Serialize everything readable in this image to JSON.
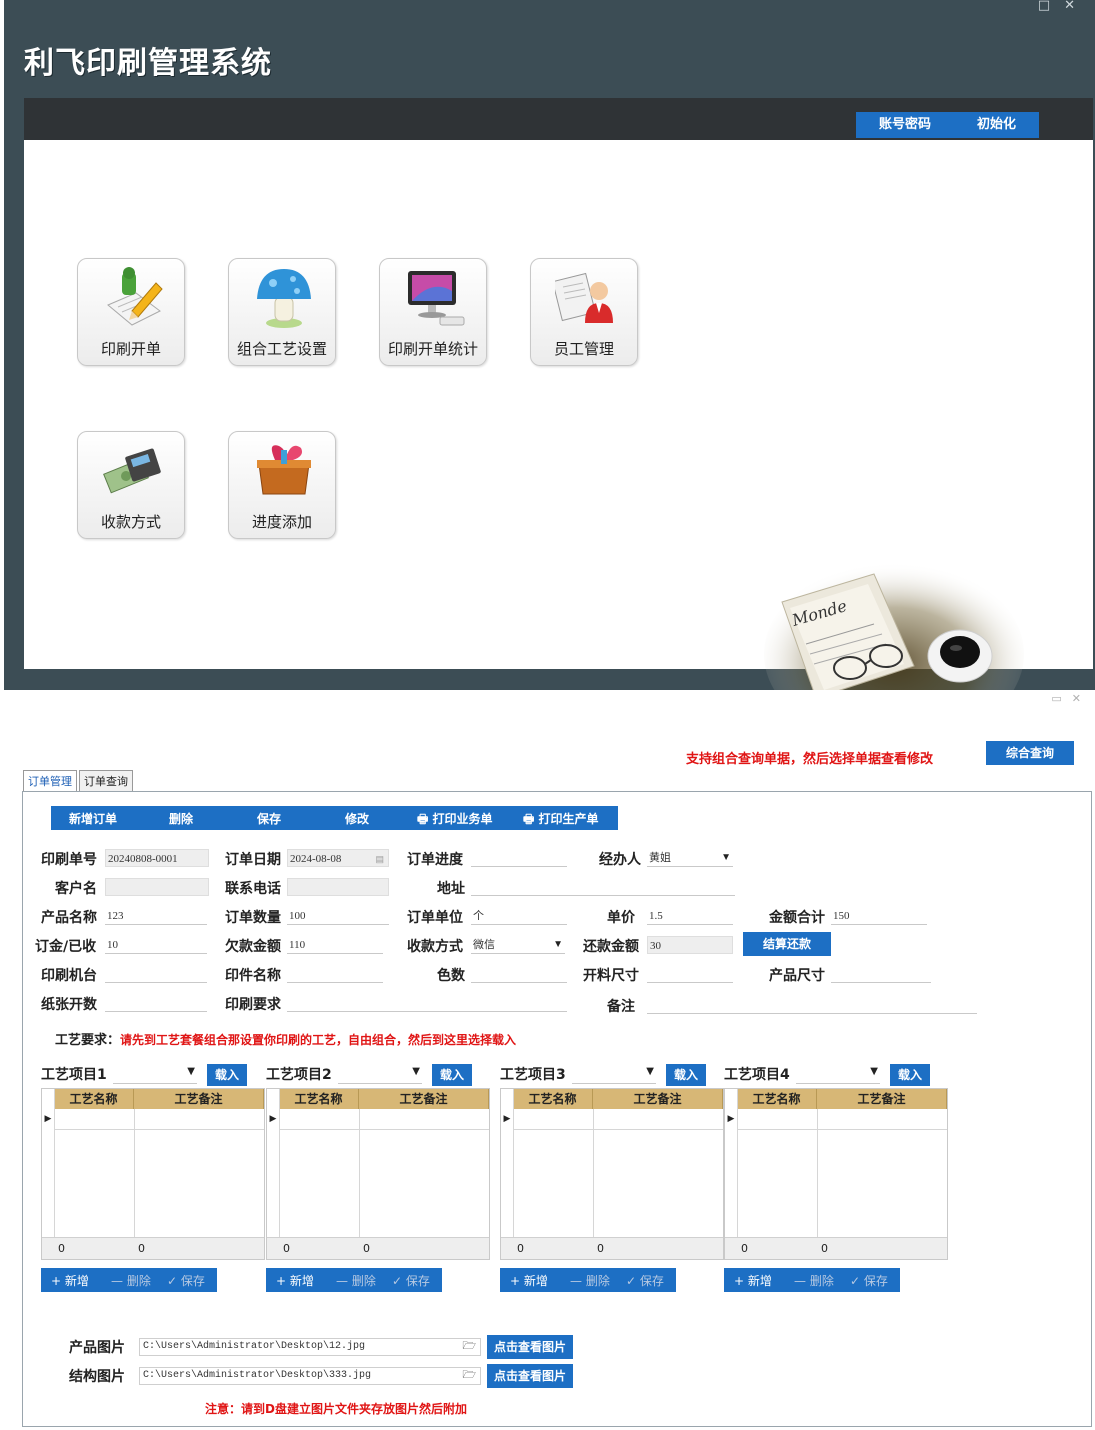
{
  "main_window": {
    "title": "利飞印刷管理系统",
    "top_actions": [
      "账号密码",
      "初始化"
    ],
    "tiles": [
      {
        "label": "印刷开单",
        "icon": "edit-pen-icon"
      },
      {
        "label": "组合工艺设置",
        "icon": "mushroom-icon"
      },
      {
        "label": "印刷开单统计",
        "icon": "computer-monitor-icon"
      },
      {
        "label": "员工管理",
        "icon": "employee-icon"
      },
      {
        "label": "收款方式",
        "icon": "money-card-icon"
      },
      {
        "label": "进度添加",
        "icon": "gift-box-icon"
      }
    ],
    "decor": {
      "newspaper_text": "Monde"
    }
  },
  "order_window": {
    "hint": "支持组合查询单据，然后选择单据查看修改",
    "combo_query_label": "综合查询",
    "tabs": [
      {
        "label": "订单管理",
        "active": true
      },
      {
        "label": "订单查询",
        "active": false
      }
    ],
    "toolbar": [
      "新增订单",
      "删除",
      "保存",
      "修改",
      "打印业务单",
      "打印生产单"
    ],
    "form": {
      "order_no": {
        "label": "印刷单号",
        "value": "20240808-0001"
      },
      "order_date": {
        "label": "订单日期",
        "value": "2024-08-08"
      },
      "progress": {
        "label": "订单进度",
        "value": ""
      },
      "handler": {
        "label": "经办人",
        "value": "黄姐"
      },
      "customer": {
        "label": "客户名",
        "value": ""
      },
      "phone": {
        "label": "联系电话",
        "value": ""
      },
      "address": {
        "label": "地址",
        "value": ""
      },
      "product_name": {
        "label": "产品名称",
        "value": "123"
      },
      "quantity": {
        "label": "订单数量",
        "value": "100"
      },
      "unit": {
        "label": "订单单位",
        "value": "个"
      },
      "unit_price": {
        "label": "单价",
        "value": "1.5"
      },
      "total": {
        "label": "金额合计",
        "value": "150"
      },
      "deposit": {
        "label": "订金/已收",
        "value": "10"
      },
      "owed": {
        "label": "欠款金额",
        "value": "110"
      },
      "pay_method": {
        "label": "收款方式",
        "value": "微信"
      },
      "repay": {
        "label": "还款金额",
        "value": "30"
      },
      "settle_label": "结算还款",
      "machine": {
        "label": "印刷机台",
        "value": ""
      },
      "print_name": {
        "label": "印件名称",
        "value": ""
      },
      "colors": {
        "label": "色数",
        "value": ""
      },
      "cut_size": {
        "label": "开料尺寸",
        "value": ""
      },
      "product_size": {
        "label": "产品尺寸",
        "value": ""
      },
      "paper_split": {
        "label": "纸张开数",
        "value": ""
      },
      "print_req": {
        "label": "印刷要求",
        "value": ""
      },
      "remark": {
        "label": "备注",
        "value": ""
      }
    },
    "process_requirement": {
      "label": "工艺要求：",
      "text": "请先到工艺套餐组合那设置你印刷的工艺，自由组合，然后到这里选择载入"
    },
    "process_items": [
      {
        "label": "工艺项目1",
        "load": "载入",
        "col1": "工艺名称",
        "col2": "工艺备注",
        "sum1": "0",
        "sum2": "0",
        "add": "+ 新增",
        "del": "— 删除",
        "save": "✓ 保存"
      },
      {
        "label": "工艺项目2",
        "load": "载入",
        "col1": "工艺名称",
        "col2": "工艺备注",
        "sum1": "0",
        "sum2": "0",
        "add": "+ 新增",
        "del": "— 删除",
        "save": "✓ 保存"
      },
      {
        "label": "工艺项目3",
        "load": "载入",
        "col1": "工艺名称",
        "col2": "工艺备注",
        "sum1": "0",
        "sum2": "0",
        "add": "+ 新增",
        "del": "— 删除",
        "save": "✓ 保存"
      },
      {
        "label": "工艺项目4",
        "load": "载入",
        "col1": "工艺名称",
        "col2": "工艺备注",
        "sum1": "0",
        "sum2": "0",
        "add": "+ 新增",
        "del": "— 删除",
        "save": "✓ 保存"
      }
    ],
    "images": [
      {
        "label": "产品图片",
        "path": "C:\\Users\\Administrator\\Desktop\\12.jpg",
        "view": "点击查看图片"
      },
      {
        "label": "结构图片",
        "path": "C:\\Users\\Administrator\\Desktop\\333.jpg",
        "view": "点击查看图片"
      }
    ],
    "note": "注意：请到D盘建立图片文件夹存放图片然后附加"
  },
  "colors": {
    "accent_blue": "#1d6fc4",
    "title_bar": "#3c4d55",
    "grid_header": "#d7b776",
    "warn_red": "#e01515"
  }
}
